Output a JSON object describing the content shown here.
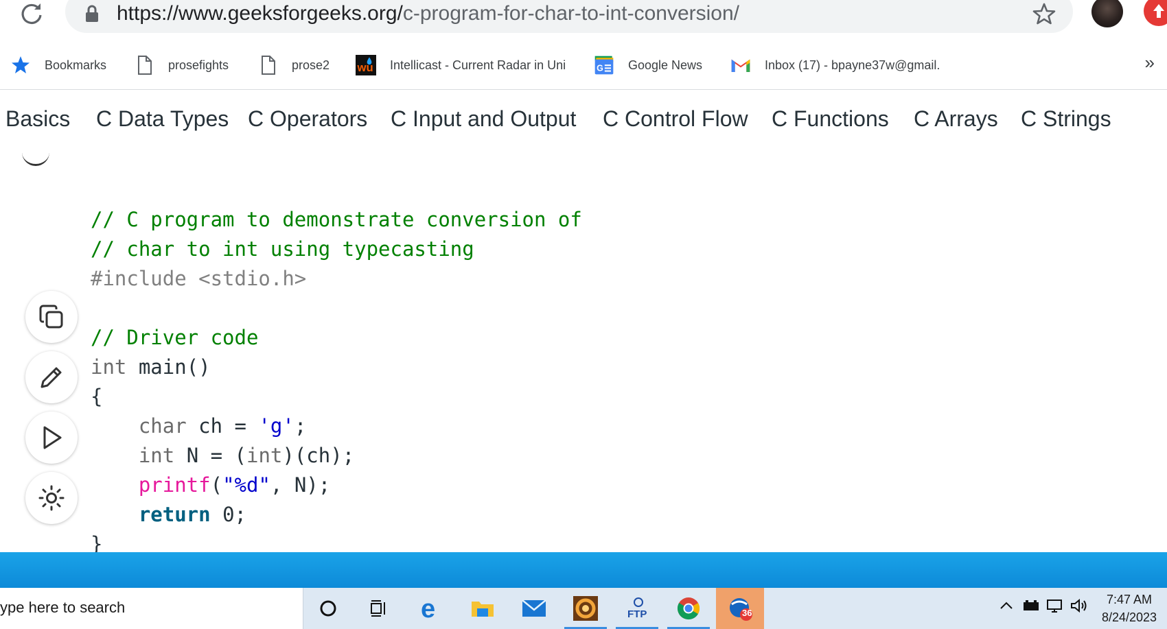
{
  "browser": {
    "url_domain": "https://www.geeksforgeeks.org/",
    "url_path": "c-program-for-char-to-int-conversion/"
  },
  "bookmarks": [
    {
      "label": "Bookmarks",
      "icon": "star-icon"
    },
    {
      "label": "prosefights",
      "icon": "page-icon"
    },
    {
      "label": "prose2",
      "icon": "page-icon"
    },
    {
      "label": "Intellicast - Current Radar in Uni",
      "icon": "intellicast-icon"
    },
    {
      "label": "Google News",
      "icon": "google-news-icon"
    },
    {
      "label": "Inbox (17) - bpayne37w@gmail.",
      "icon": "gmail-icon"
    }
  ],
  "nav": [
    "Basics",
    "C Data Types",
    "C Operators",
    "C Input and Output",
    "C Control Flow",
    "C Functions",
    "C Arrays",
    "C Strings"
  ],
  "code": {
    "c1": "// C program to demonstrate conversion of",
    "c2": "// char to int using typecasting",
    "inc": "#include <stdio.h>",
    "c3": "// Driver code",
    "l_int": "int",
    "l_main": " main()",
    "l_open": "{",
    "l_char": "char",
    "l_ch": " ch = ",
    "l_g": "'g'",
    "l_semi": ";",
    "l_int2": "int",
    "l_n1": " N = (",
    "l_int3": "int",
    "l_n2": ")(ch);",
    "l_printf": "printf",
    "l_p1": "(",
    "l_fmt": "\"%d\"",
    "l_p2": ", N);",
    "l_return": "return",
    "l_ret": " 0;",
    "l_close": "}"
  },
  "taskbar": {
    "search_placeholder": "ype here to search",
    "badge": "36",
    "time": "7:47 AM",
    "date": "8/24/2023"
  }
}
